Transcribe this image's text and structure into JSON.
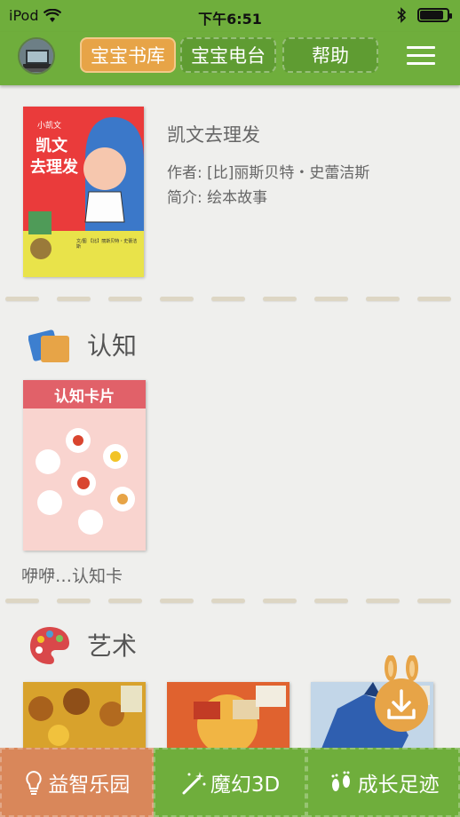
{
  "status_bar": {
    "carrier": "iPod",
    "time": "下午6:51",
    "battery_level": 0.85
  },
  "nav": {
    "tabs": [
      {
        "label": "宝宝书库",
        "active": true
      },
      {
        "label": "宝宝电台",
        "active": false
      },
      {
        "label": "帮助",
        "active": false
      }
    ]
  },
  "featured": {
    "title": "凯文去理发",
    "author": "作者: [比]丽斯贝特・史蕾洁斯",
    "summary": "简介: 绘本故事",
    "cover": {
      "series": "小凯文",
      "title_line1": "凯文",
      "title_line2": "去理发",
      "credit": "文/图 【比】丽斯贝特・史蕾洁斯"
    }
  },
  "sections": {
    "cognition": {
      "title": "认知",
      "books": [
        {
          "caption": "咿咿…认知卡",
          "cover_title": "认知卡片"
        }
      ]
    },
    "art": {
      "title": "艺术"
    }
  },
  "bottom_nav": [
    {
      "label": "益智乐园",
      "icon": "lightbulb-icon"
    },
    {
      "label": "魔幻3D",
      "icon": "magic-wand-icon"
    },
    {
      "label": "成长足迹",
      "icon": "footprints-icon"
    }
  ],
  "colors": {
    "nav_green": "#6fae3c",
    "active_tab": "#e7a447",
    "bottom_active": "#d9875a",
    "fab_orange": "#e7a447"
  }
}
